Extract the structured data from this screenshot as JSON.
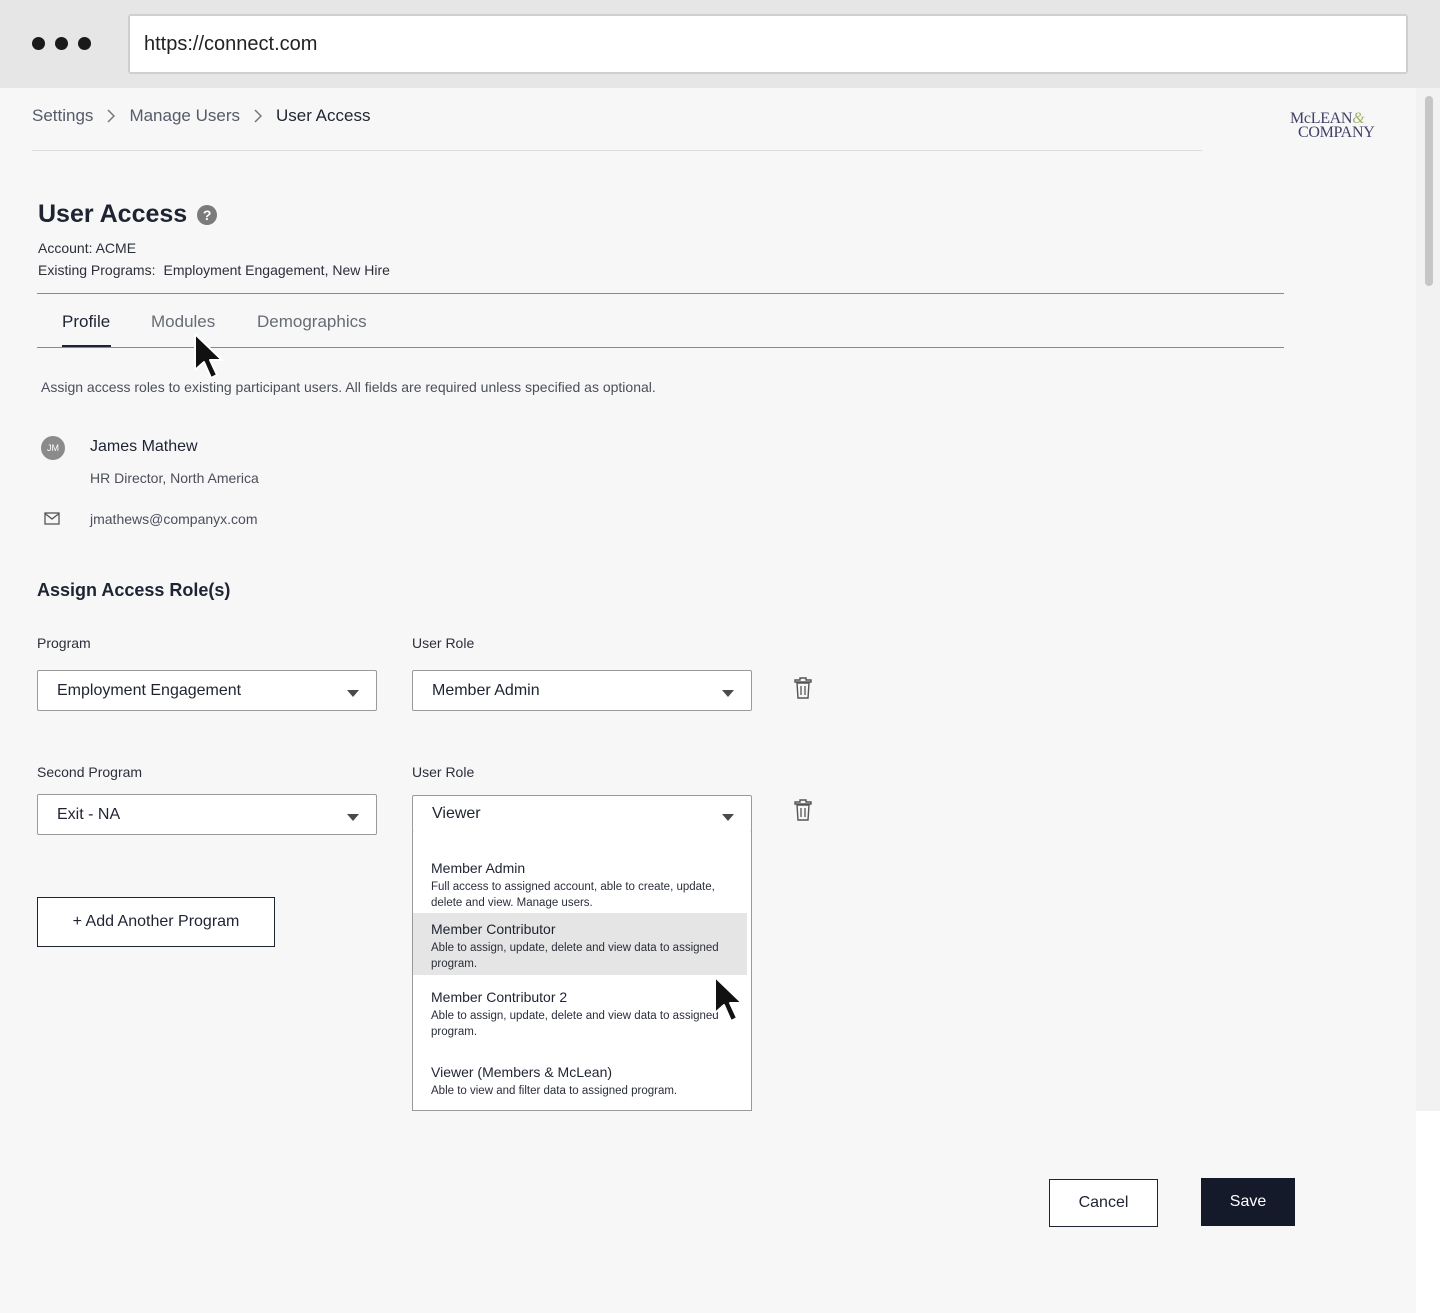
{
  "browser": {
    "url": "https://connect.com"
  },
  "breadcrumb": {
    "items": [
      "Settings",
      "Manage Users",
      "User Access"
    ]
  },
  "brand": {
    "line1": "McLEAN",
    "amp": "&",
    "line2": "COMPANY"
  },
  "header": {
    "title": "User Access",
    "help_glyph": "?",
    "account_label": "Account: ACME",
    "programs_label": "Existing Programs:",
    "programs_value": "Employment Engagement, New Hire"
  },
  "tabs": [
    {
      "label": "Profile",
      "active": true
    },
    {
      "label": "Modules",
      "active": false
    },
    {
      "label": "Demographics",
      "active": false
    }
  ],
  "instructions": "Assign access roles to existing participant users. All fields are required unless specified as optional.",
  "user": {
    "initials": "JM",
    "name": "James Mathew",
    "title": "HR Director, North America",
    "email": "jmathews@companyx.com"
  },
  "assign": {
    "section_title": "Assign Access Role(s)",
    "rows": [
      {
        "program_label": "Program",
        "program_value": "Employment Engagement",
        "role_label": "User Role",
        "role_value": "Member Admin"
      },
      {
        "program_label": "Second Program",
        "program_value": "Exit - NA",
        "role_label": "User Role",
        "role_value": "Viewer"
      }
    ],
    "add_button": "+ Add Another Program"
  },
  "role_dropdown": {
    "highlighted_index": 1,
    "options": [
      {
        "title": "Member Admin",
        "desc": "Full access to assigned account, able to create, update, delete and view. Manage users."
      },
      {
        "title": "Member Contributor",
        "desc": "Able to assign, update, delete and view data to assigned program."
      },
      {
        "title": "Member Contributor 2",
        "desc": "Able to assign, update, delete and view data to assigned program."
      },
      {
        "title": "Viewer (Members & McLean)",
        "desc": "Able to view and filter data to assigned program."
      }
    ]
  },
  "footer": {
    "cancel": "Cancel",
    "save": "Save"
  },
  "icons": {
    "window_controls": "three-dots-icon",
    "help": "help-circle-icon",
    "breadcrumb_separator": "chevron-right-icon",
    "mail": "mail-icon",
    "trash": "trash-icon",
    "select_caret": "caret-down-icon",
    "pointer": "mouse-pointer-icon"
  },
  "colors": {
    "primary_dark": "#141a29",
    "page_bg": "#f7f7f7",
    "highlight": "#e5e5e5"
  }
}
